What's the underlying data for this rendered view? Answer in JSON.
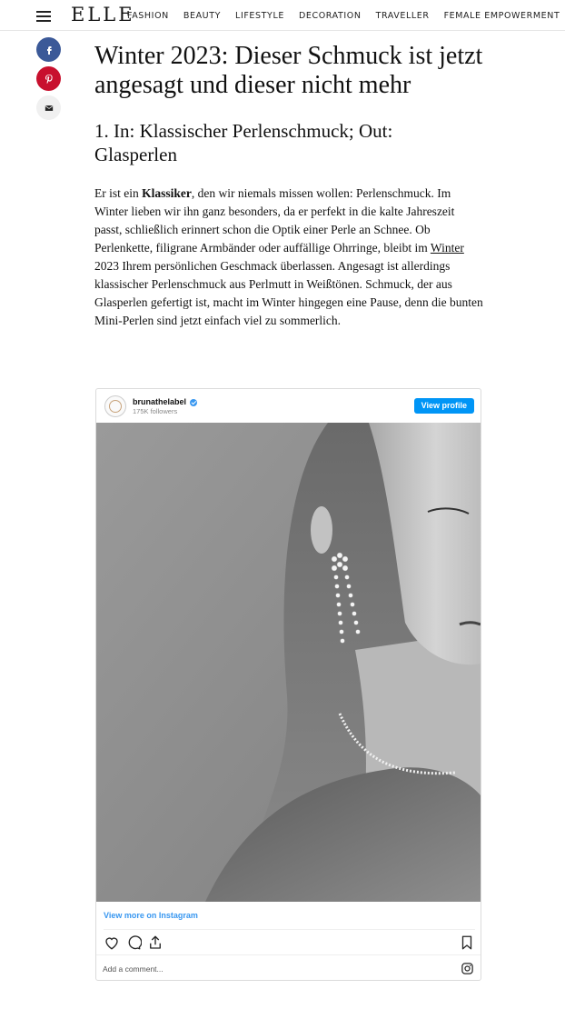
{
  "nav": {
    "logo": "ELLE",
    "links": [
      "FASHION",
      "BEAUTY",
      "LIFESTYLE",
      "DECORATION",
      "TRAVELLER",
      "FEMALE EMPOWERMENT"
    ]
  },
  "share": {
    "icons": [
      "facebook-icon",
      "pinterest-icon",
      "mail-icon"
    ],
    "colors": {
      "facebook": "#3b5998",
      "pinterest": "#c8102e",
      "mail": "#f0f0f0"
    }
  },
  "article": {
    "title": "Winter 2023: Dieser Schmuck ist jetzt angesagt und dieser nicht mehr",
    "section_heading": "1. In: Klassischer Perlenschmuck; Out: Glasperlen",
    "body": {
      "p1_before": "Er ist ein ",
      "p1_bold": "Klassiker",
      "p1_mid": ", den wir niemals missen wollen: Perlenschmuck. Im Winter lieben wir ihn ganz besonders, da er perfekt in die kalte Jahreszeit passt, schließlich erinnert schon die Optik einer Perle an Schnee. Ob Perlenkette, filigrane Armbänder oder auffällige Ohrringe, bleibt im ",
      "p1_link": "Winter",
      "p1_after": " 2023 Ihrem persönlichen Geschmack überlassen. Angesagt ist allerdings klassischer Perlenschmuck aus Perlmutt in Weißtönen. Schmuck, der aus Glasperlen gefertigt ist, macht im Winter hingegen eine Pause, denn die bunten Mini-Perlen sind jetzt einfach viel zu sommerlich."
    }
  },
  "instagram": {
    "username": "brunathelabel",
    "followers": "175K followers",
    "view_profile": "View profile",
    "view_more": "View more on Instagram",
    "add_comment": "Add a comment...",
    "accent": "#0095f6"
  }
}
